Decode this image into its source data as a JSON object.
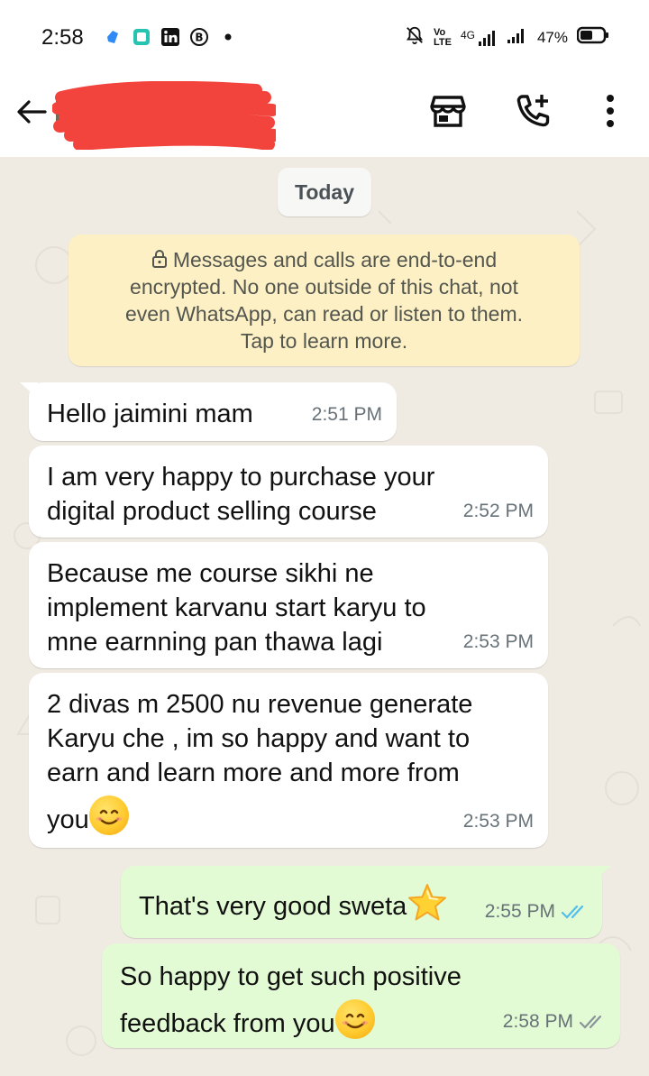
{
  "status_bar": {
    "time": "2:58",
    "network_label_top": "Vo",
    "network_label_bottom": "LTE",
    "network_type": "4G",
    "battery": "47%",
    "icons": [
      "app-blue-icon",
      "app-teal-icon",
      "linkedin-icon",
      "b-circle-icon",
      "dot-icon",
      "bell-muted-icon",
      "volte-icon",
      "signal-icon",
      "signal-icon",
      "battery-icon"
    ]
  },
  "app_bar": {
    "icons": [
      "back-arrow-icon",
      "store-icon",
      "add-call-icon",
      "more-vert-icon"
    ]
  },
  "chat": {
    "date_chip": "Today",
    "encryption": {
      "lines": [
        "Messages and calls are end-to-end",
        "encrypted. No one outside of this chat, not",
        "even WhatsApp, can read or listen to them.",
        "Tap to learn more."
      ]
    },
    "messages": [
      {
        "dir": "in",
        "lines": [
          "Hello jaimini mam"
        ],
        "time": "2:51 PM"
      },
      {
        "dir": "in",
        "lines": [
          "I am very happy to purchase your",
          "digital product selling course"
        ],
        "time": "2:52 PM"
      },
      {
        "dir": "in",
        "lines": [
          "Because me course sikhi ne",
          "implement karvanu start karyu to",
          "mne earnning pan thawa lagi"
        ],
        "time": "2:53 PM"
      },
      {
        "dir": "in",
        "lines": [
          "2 divas m 2500 nu revenue generate",
          "Karyu che , im so happy and want to",
          "earn and learn more and more from",
          "you"
        ],
        "time": "2:53 PM",
        "emoji": "smiling-face-emoji"
      },
      {
        "dir": "out",
        "lines": [
          "That's very good sweta"
        ],
        "time": "2:55 PM",
        "emoji": "glowing-star-emoji",
        "read": true
      },
      {
        "dir": "out",
        "lines": [
          "So happy to get such positive",
          "feedback from you"
        ],
        "time": "2:58 PM",
        "emoji": "smiling-face-emoji",
        "read": false
      }
    ]
  },
  "colors": {
    "chat_bg": "#efeae2",
    "incoming_bubble": "#ffffff",
    "outgoing_bubble": "#e3fbd4",
    "encryption_bg": "#fdf0c4",
    "read_tick": "#53bdeb",
    "delivered_tick": "#8a9399"
  }
}
